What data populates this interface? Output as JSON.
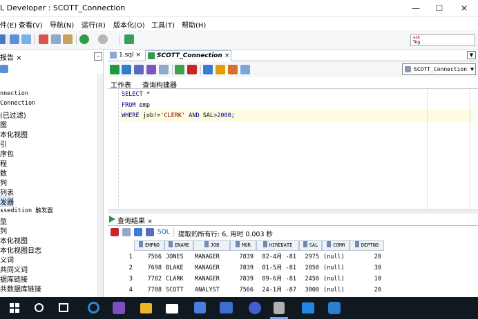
{
  "window": {
    "title": "L Developer : SCOTT_Connection",
    "minimize": "—",
    "maximize": "☐",
    "close": "✕"
  },
  "menu": [
    "件(E)",
    "查看(V)",
    "导航(N)",
    "运行(R)",
    "版本化(O)",
    "工具(T)",
    "帮助(H)"
  ],
  "search": {
    "line1": "ask",
    "line2": "Tog"
  },
  "left_panel": {
    "tab_label": "报告",
    "tab_close": "×",
    "min_label": "–",
    "items": [
      {
        "text": "nnection",
        "mono": true
      },
      {
        "text": "Connection",
        "mono": true
      },
      {
        "text": "(已过滤)",
        "mono": false
      },
      {
        "text": "图",
        "mono": false
      },
      {
        "text": "本化视图",
        "mono": false
      },
      {
        "text": "引",
        "mono": false
      },
      {
        "text": "序包",
        "mono": false
      },
      {
        "text": "程",
        "mono": false
      },
      {
        "text": "数",
        "mono": false
      },
      {
        "text": "列",
        "mono": false
      },
      {
        "text": "列表",
        "mono": false
      },
      {
        "text": "发器",
        "mono": false
      },
      {
        "text": "ssedition 触发器",
        "mono": true
      },
      {
        "text": "型",
        "mono": false
      },
      {
        "text": "列",
        "mono": false
      },
      {
        "text": "本化视图",
        "mono": false
      },
      {
        "text": "本化视图日志",
        "mono": false
      },
      {
        "text": "义词",
        "mono": false
      },
      {
        "text": "共同义词",
        "mono": false
      },
      {
        "text": "据库链接",
        "mono": false
      },
      {
        "text": "共数据库链接",
        "mono": false
      }
    ]
  },
  "doc_tabs": [
    {
      "label": "1.sql",
      "close": "×",
      "active": false
    },
    {
      "label": "SCOTT_Connection",
      "close": "×",
      "active": true
    }
  ],
  "connection_select": "SCOTT_Connection",
  "sub_tabs": [
    "工作表",
    "查询构建器"
  ],
  "sql": {
    "line1_kw": "SELECT",
    "line1_rest": " *",
    "line2_kw": "FROM",
    "line2_rest": " emp",
    "line3_kw1": "WHERE",
    "line3_a": " job!=",
    "line3_str": "'CLERK'",
    "line3_kw2": " AND",
    "line3_b": " SAL>",
    "line3_num": "2000",
    "line3_end": ";"
  },
  "results": {
    "tab_label": "查询结果",
    "tab_close": "×",
    "sql_label": "SQL",
    "status": "提取的所有行: 6, 用时 0.003 秒",
    "columns": [
      "EMPNO",
      "ENAME",
      "JOB",
      "MGR",
      "HIREDATE",
      "SAL",
      "COMM",
      "DEPTNO"
    ],
    "rows": [
      [
        "1",
        "7566",
        "JONES",
        "MANAGER",
        "7839",
        "02-4月 -81",
        "2975",
        "(null)",
        "20"
      ],
      [
        "2",
        "7698",
        "BLAKE",
        "MANAGER",
        "7839",
        "01-5月 -81",
        "2850",
        "(null)",
        "30"
      ],
      [
        "3",
        "7782",
        "CLARK",
        "MANAGER",
        "7839",
        "09-6月 -81",
        "2450",
        "(null)",
        "10"
      ],
      [
        "4",
        "7788",
        "SCOTT",
        "ANALYST",
        "7566",
        "24-1月 -87",
        "3000",
        "(null)",
        "20"
      ]
    ]
  },
  "colors": {
    "keyword": "#00008b",
    "string": "#8b0000",
    "number": "#0000aa",
    "taskbar": "#101820",
    "current_line": "#fdfbe0"
  }
}
